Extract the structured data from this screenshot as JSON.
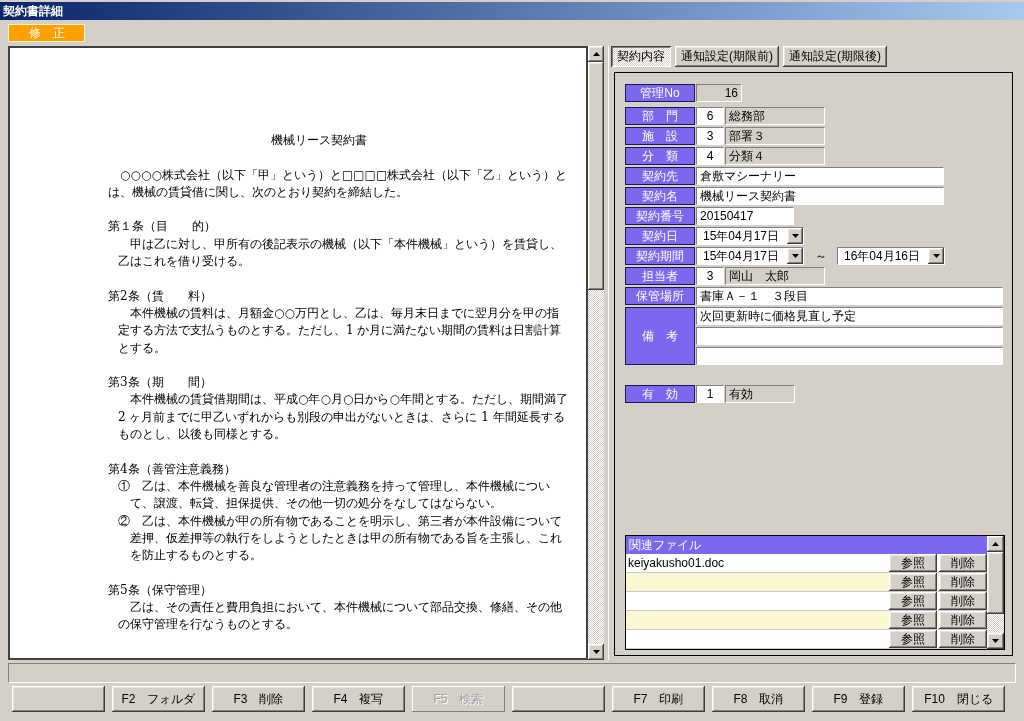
{
  "window": {
    "title": "契約書詳細"
  },
  "mode_badge": "修　正",
  "document": {
    "title": "機械リース契約書",
    "intro": "○○○○株式会社（以下「甲」という）と□□□□株式会社（以下「乙」という）とは、機械の賃貸借に関し、次のとおり契約を締結した。",
    "articles": [
      {
        "heading": "第１条（目　　的）",
        "kind": "prose",
        "paragraphs": [
          "甲は乙に対し、甲所有の後記表示の機械（以下「本件機械」という）を賃貸し、乙はこれを借り受ける。"
        ]
      },
      {
        "heading": "第2条（賃　　料）",
        "kind": "prose",
        "paragraphs": [
          "本件機械の賃料は、月額金○○万円とし、乙は、毎月末日までに翌月分を甲の指定する方法で支払うものとする。ただし、1 か月に満たない期間の賃料は日割計算とする。"
        ]
      },
      {
        "heading": "第3条（期　　間）",
        "kind": "prose",
        "paragraphs": [
          "本件機械の賃貸借期間は、平成○年○月○日から○年間とする。ただし、期間満了2 ヶ月前までに甲乙いずれからも別段の申出がないときは、さらに 1 年間延長するものとし、以後も同様とする。"
        ]
      },
      {
        "heading": "第4条（善管注意義務）",
        "kind": "numbered",
        "paragraphs": [
          "①　乙は、本件機械を善良な管理者の注意義務を持って管理し、本件機械について、譲渡、転貸、担保提供、その他一切の処分をなしてはならない。",
          "②　乙は、本件機械が甲の所有物であることを明示し、第三者が本件設備について差押、仮差押等の執行をしようとしたときは甲の所有物である旨を主張し、これを防止するものとする。"
        ]
      },
      {
        "heading": "第5条（保守管理）",
        "kind": "prose",
        "paragraphs": [
          "乙は、その責任と費用負担において、本件機械について部品交換、修繕、その他の保守管理を行なうものとする。"
        ]
      }
    ]
  },
  "tabs": [
    {
      "label": "契約内容",
      "selected": true
    },
    {
      "label": "通知設定(期限前)",
      "selected": false
    },
    {
      "label": "通知設定(期限後)",
      "selected": false
    }
  ],
  "form": {
    "sections": [
      {
        "fields": [
          {
            "kind": "display",
            "label": "管理No",
            "value": "16"
          }
        ]
      },
      {
        "fields": [
          {
            "kind": "code",
            "label": "部　門",
            "code": "6",
            "name": "総務部"
          },
          {
            "kind": "code",
            "label": "施　設",
            "code": "3",
            "name": "部署３"
          },
          {
            "kind": "code",
            "label": "分　類",
            "code": "4",
            "name": "分類４"
          },
          {
            "kind": "text",
            "label": "契約先",
            "value": "倉敷マシーナリー"
          },
          {
            "kind": "text",
            "label": "契約名",
            "value": "機械リース契約書"
          },
          {
            "kind": "number",
            "label": "契約番号",
            "value": "20150417"
          },
          {
            "kind": "date",
            "label": "契約日",
            "value": "15年04月17日"
          },
          {
            "kind": "period",
            "label": "契約期間",
            "from": "15年04月17日",
            "separator": "～",
            "to": "16年04月16日"
          },
          {
            "kind": "code",
            "label": "担当者",
            "code": "3",
            "name": "岡山　太郎"
          },
          {
            "kind": "wide",
            "label": "保管場所",
            "value": "書庫Ａ－１　３段目"
          },
          {
            "kind": "memo",
            "label": "備　考",
            "lines": [
              "次回更新時に価格見直し予定"
            ]
          }
        ]
      },
      {
        "fields": [
          {
            "kind": "flag",
            "label": "有　効",
            "code": "1",
            "name": "有効"
          }
        ]
      }
    ]
  },
  "related_files": {
    "title": "関連ファイル",
    "rows": [
      {
        "file": "keiyakusho01.doc",
        "view": "参照",
        "delete": "削除"
      },
      {
        "view": "参照",
        "delete": "削除"
      },
      {
        "view": "参照",
        "delete": "削除"
      },
      {
        "view": "参照",
        "delete": "削除"
      },
      {
        "view": "参照",
        "delete": "削除"
      }
    ]
  },
  "function_keys": [
    {
      "kind": "blank",
      "disabled": false
    },
    {
      "kind": "command",
      "label": "F2　フォルダ",
      "disabled": false
    },
    {
      "kind": "command",
      "label": "F3　削除",
      "disabled": false
    },
    {
      "kind": "command",
      "label": "F4　複写",
      "disabled": false
    },
    {
      "kind": "command",
      "label": "F5　検索",
      "disabled": true
    },
    {
      "kind": "blank",
      "disabled": false
    },
    {
      "kind": "command",
      "label": "F7　印刷",
      "disabled": false
    },
    {
      "kind": "command",
      "label": "F8　取消",
      "disabled": false
    },
    {
      "kind": "command",
      "label": "F9　登録",
      "disabled": false
    },
    {
      "kind": "command",
      "label": "F10　閉じる",
      "disabled": false
    }
  ]
}
